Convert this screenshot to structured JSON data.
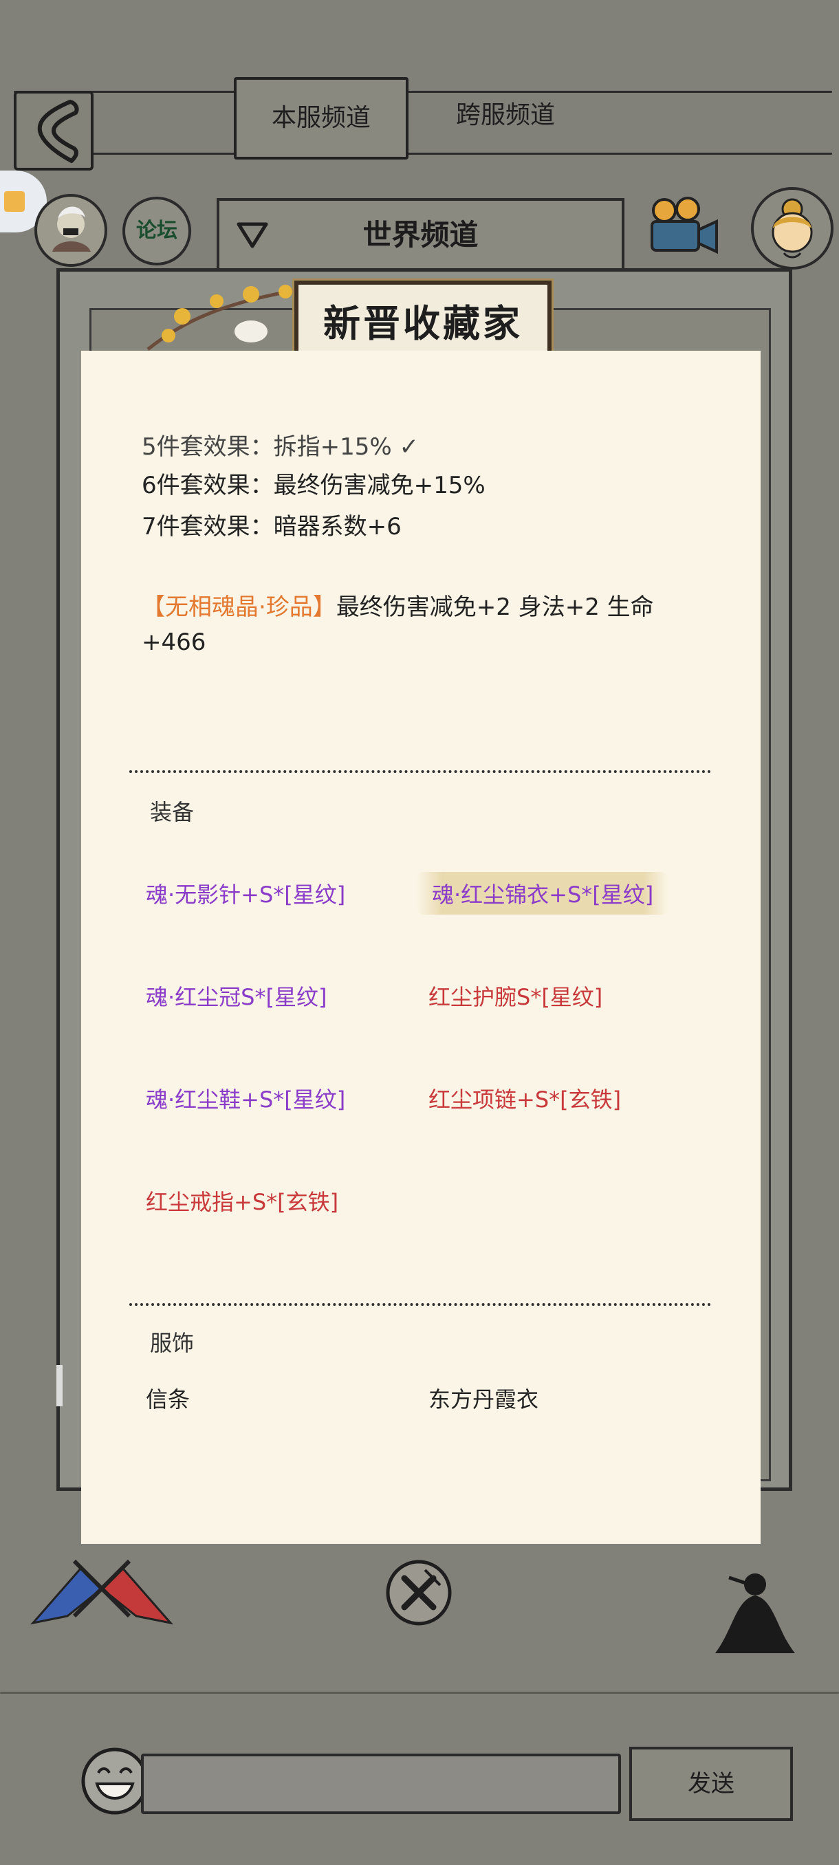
{
  "tabs": {
    "local": "本服频道",
    "cross": "跨服频道"
  },
  "channel": {
    "name": "世界频道",
    "forum_label": "论坛"
  },
  "frame_title": "新晋收藏家",
  "set_effects": {
    "partial": "5件套效果：拆指+15% ✓",
    "six": "6件套效果：最终伤害减免+15%",
    "seven": "7件套效果：暗器系数+6"
  },
  "soul_crystal": {
    "name": "【无相魂晶·珍品】",
    "effect_line1": "最终伤害减免+2 身法+2 生命",
    "effect_line2": "+466"
  },
  "equipment": {
    "title": "装备",
    "items": [
      {
        "label": "魂·无影针+S*[星纹]",
        "color": "#8a3bc9"
      },
      {
        "label": "魂·红尘锦衣+S*[星纹]",
        "color": "#8a3bc9"
      },
      {
        "label": "魂·红尘冠S*[星纹]",
        "color": "#8a3bc9"
      },
      {
        "label": "红尘护腕S*[星纹]",
        "color": "#c9393b"
      },
      {
        "label": "魂·红尘鞋+S*[星纹]",
        "color": "#8a3bc9"
      },
      {
        "label": "红尘项链+S*[玄铁]",
        "color": "#c9393b"
      },
      {
        "label": "红尘戒指+S*[玄铁]",
        "color": "#c9393b"
      }
    ]
  },
  "costume": {
    "title": "服饰",
    "items": [
      {
        "label": "信条"
      },
      {
        "label": "东方丹霞衣"
      }
    ]
  },
  "chat_input": {
    "placeholder": ""
  },
  "send_label": "发送",
  "colors": {
    "background": "#818079",
    "modal": "#faf5e6",
    "soul_orange": "#e3782e"
  }
}
